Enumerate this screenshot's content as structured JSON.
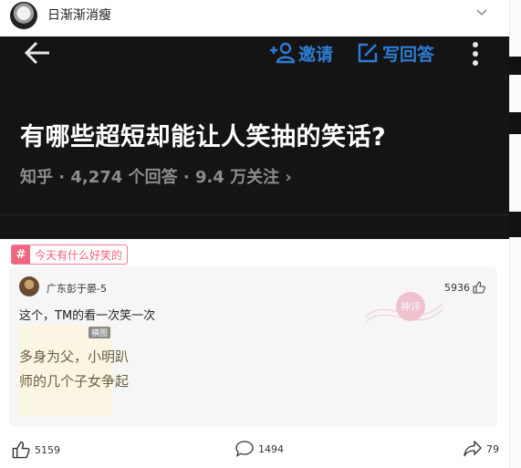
{
  "header": {
    "title": "日渐渐消瘦"
  },
  "question": {
    "invite_label": "邀请",
    "write_label": "写回答",
    "title": "有哪些超短却能让人笑抽的笑话?",
    "meta": "知乎 · 4,274 个回答 · 9.4 万关注 ›"
  },
  "topic": {
    "icon_text": "#",
    "label": "今天有什么好笑的"
  },
  "answer": {
    "author": "广东彭于晏-5",
    "likes": "5936",
    "snippet": "这个，TM的看一次笑一次",
    "thumb_badge": "横图",
    "thumb_line1": "多身为父，小明趴",
    "thumb_line2": "师的几个子女争起",
    "stamp_text": "神评"
  },
  "actions": {
    "like_count": "5159",
    "comment_count": "1494",
    "share_count": "79"
  },
  "colors": {
    "accent_blue": "#2d7dd6",
    "tag_pink": "#f06580",
    "dark_bg": "#141414"
  }
}
